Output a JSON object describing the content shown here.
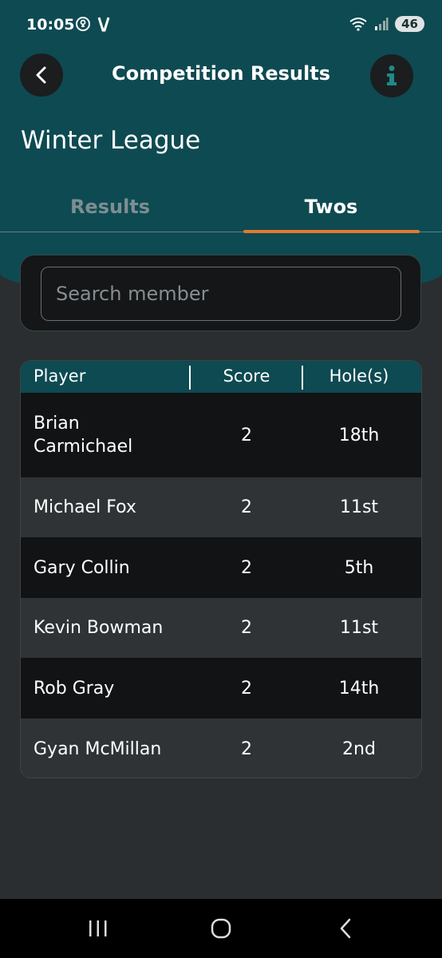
{
  "status": {
    "time": "10:05",
    "battery": "46"
  },
  "header": {
    "title": "Competition Results"
  },
  "competition": {
    "name": "Winter League"
  },
  "tabs": [
    {
      "label": "Results"
    },
    {
      "label": "Twos"
    }
  ],
  "search": {
    "placeholder": "Search member",
    "value": ""
  },
  "table": {
    "columns": [
      "Player",
      "Score",
      "Hole(s)"
    ],
    "rows": [
      {
        "player": "Brian\nCarmichael",
        "score": "2",
        "hole": "18th"
      },
      {
        "player": "Michael Fox",
        "score": "2",
        "hole": "11st"
      },
      {
        "player": "Gary Collin",
        "score": "2",
        "hole": "5th"
      },
      {
        "player": "Kevin Bowman",
        "score": "2",
        "hole": "11st"
      },
      {
        "player": "Rob Gray",
        "score": "2",
        "hole": "14th"
      },
      {
        "player": "Gyan McMillan",
        "score": "2",
        "hole": "2nd"
      }
    ]
  },
  "colors": {
    "header_teal": "#0e4a52",
    "accent": "#e07a2e",
    "row_dark": "#121314",
    "row_light": "#2f3336"
  }
}
